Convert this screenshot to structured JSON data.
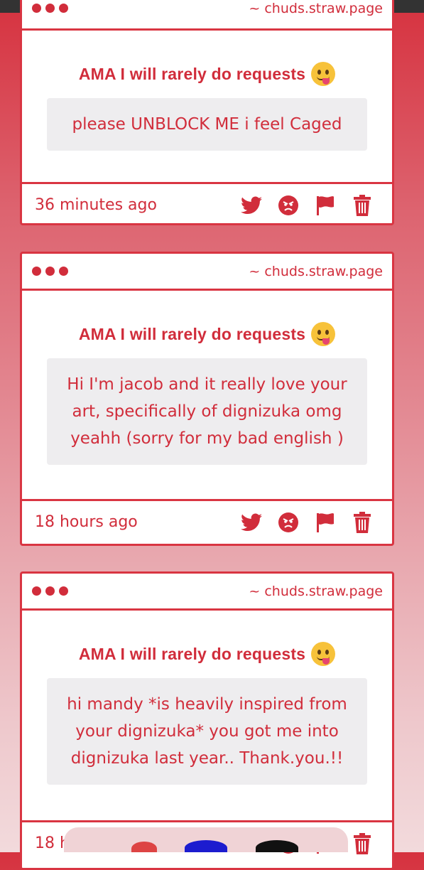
{
  "colors": {
    "accent": "#d93542"
  },
  "cards": [
    {
      "domain": "~ chuds.straw.page",
      "title": "AMA I will rarely do requests",
      "question": "please UNBLOCK ME i feel Caged",
      "time": "36 minutes ago"
    },
    {
      "domain": "~ chuds.straw.page",
      "title": "AMA I will rarely do requests",
      "question": "Hi I'm jacob and it really love your art, specifically of dignizuka omg yeahh (sorry for my bad english )",
      "time": "18 hours ago"
    },
    {
      "domain": "~ chuds.straw.page",
      "title": "AMA I will rarely do requests",
      "question": "hi mandy *is heavily inspired from your dignizuka* you got me into dignizuka last year.. Thank.you.!!",
      "time": "18 hours ago"
    }
  ],
  "icons": [
    "twitter-icon",
    "angry-face-icon",
    "flag-icon",
    "trash-icon"
  ]
}
